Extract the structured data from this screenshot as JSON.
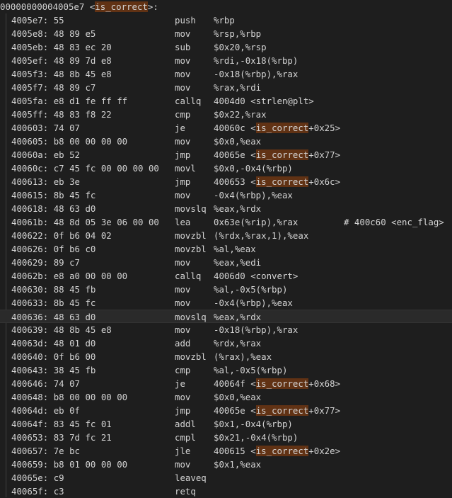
{
  "header": {
    "address": "00000000004005e7",
    "open": "<",
    "symbol": "is_correct",
    "close": ">:"
  },
  "lines": [
    {
      "addr": "4005e7:",
      "bytes": "55",
      "mnem": "push",
      "ops": "%rbp"
    },
    {
      "addr": "4005e8:",
      "bytes": "48 89 e5",
      "mnem": "mov",
      "ops": "%rsp,%rbp"
    },
    {
      "addr": "4005eb:",
      "bytes": "48 83 ec 20",
      "mnem": "sub",
      "ops": "$0x20,%rsp"
    },
    {
      "addr": "4005ef:",
      "bytes": "48 89 7d e8",
      "mnem": "mov",
      "ops": "%rdi,-0x18(%rbp)"
    },
    {
      "addr": "4005f3:",
      "bytes": "48 8b 45 e8",
      "mnem": "mov",
      "ops": "-0x18(%rbp),%rax"
    },
    {
      "addr": "4005f7:",
      "bytes": "48 89 c7",
      "mnem": "mov",
      "ops": "%rax,%rdi"
    },
    {
      "addr": "4005fa:",
      "bytes": "e8 d1 fe ff ff",
      "mnem": "callq",
      "ops": "4004d0 <strlen@plt>"
    },
    {
      "addr": "4005ff:",
      "bytes": "48 83 f8 22",
      "mnem": "cmp",
      "ops": "$0x22,%rax"
    },
    {
      "addr": "400603:",
      "bytes": "74 07",
      "mnem": "je",
      "ops_pre": "40060c <",
      "ops_hl": "is_correct",
      "ops_post": "+0x25>"
    },
    {
      "addr": "400605:",
      "bytes": "b8 00 00 00 00",
      "mnem": "mov",
      "ops": "$0x0,%eax"
    },
    {
      "addr": "40060a:",
      "bytes": "eb 52",
      "mnem": "jmp",
      "ops_pre": "40065e <",
      "ops_hl": "is_correct",
      "ops_post": "+0x77>"
    },
    {
      "addr": "40060c:",
      "bytes": "c7 45 fc 00 00 00 00",
      "mnem": "movl",
      "ops": "$0x0,-0x4(%rbp)"
    },
    {
      "addr": "400613:",
      "bytes": "eb 3e",
      "mnem": "jmp",
      "ops_pre": "400653 <",
      "ops_hl": "is_correct",
      "ops_post": "+0x6c>"
    },
    {
      "addr": "400615:",
      "bytes": "8b 45 fc",
      "mnem": "mov",
      "ops": "-0x4(%rbp),%eax"
    },
    {
      "addr": "400618:",
      "bytes": "48 63 d0",
      "mnem": "movslq",
      "ops": "%eax,%rdx"
    },
    {
      "addr": "40061b:",
      "bytes": "48 8d 05 3e 06 00 00",
      "mnem": "lea",
      "ops": "0x63e(%rip),%rax",
      "comment": "# 400c60 <enc_flag>"
    },
    {
      "addr": "400622:",
      "bytes": "0f b6 04 02",
      "mnem": "movzbl",
      "ops": "(%rdx,%rax,1),%eax"
    },
    {
      "addr": "400626:",
      "bytes": "0f b6 c0",
      "mnem": "movzbl",
      "ops": "%al,%eax"
    },
    {
      "addr": "400629:",
      "bytes": "89 c7",
      "mnem": "mov",
      "ops": "%eax,%edi"
    },
    {
      "addr": "40062b:",
      "bytes": "e8 a0 00 00 00",
      "mnem": "callq",
      "ops": "4006d0 <convert>"
    },
    {
      "addr": "400630:",
      "bytes": "88 45 fb",
      "mnem": "mov",
      "ops": "%al,-0x5(%rbp)"
    },
    {
      "addr": "400633:",
      "bytes": "8b 45 fc",
      "mnem": "mov",
      "ops": "-0x4(%rbp),%eax"
    },
    {
      "addr": "400636:",
      "bytes": "48 63 d0",
      "mnem": "movslq",
      "ops": "%eax,%rdx",
      "current": true
    },
    {
      "addr": "400639:",
      "bytes": "48 8b 45 e8",
      "mnem": "mov",
      "ops": "-0x18(%rbp),%rax"
    },
    {
      "addr": "40063d:",
      "bytes": "48 01 d0",
      "mnem": "add",
      "ops": "%rdx,%rax"
    },
    {
      "addr": "400640:",
      "bytes": "0f b6 00",
      "mnem": "movzbl",
      "ops": "(%rax),%eax"
    },
    {
      "addr": "400643:",
      "bytes": "38 45 fb",
      "mnem": "cmp",
      "ops": "%al,-0x5(%rbp)"
    },
    {
      "addr": "400646:",
      "bytes": "74 07",
      "mnem": "je",
      "ops_pre": "40064f <",
      "ops_hl": "is_correct",
      "ops_post": "+0x68>"
    },
    {
      "addr": "400648:",
      "bytes": "b8 00 00 00 00",
      "mnem": "mov",
      "ops": "$0x0,%eax"
    },
    {
      "addr": "40064d:",
      "bytes": "eb 0f",
      "mnem": "jmp",
      "ops_pre": "40065e <",
      "ops_hl": "is_correct",
      "ops_post": "+0x77>"
    },
    {
      "addr": "40064f:",
      "bytes": "83 45 fc 01",
      "mnem": "addl",
      "ops": "$0x1,-0x4(%rbp)"
    },
    {
      "addr": "400653:",
      "bytes": "83 7d fc 21",
      "mnem": "cmpl",
      "ops": "$0x21,-0x4(%rbp)"
    },
    {
      "addr": "400657:",
      "bytes": "7e bc",
      "mnem": "jle",
      "ops_pre": "400615 <",
      "ops_hl": "is_correct",
      "ops_post": "+0x2e>"
    },
    {
      "addr": "400659:",
      "bytes": "b8 01 00 00 00",
      "mnem": "mov",
      "ops": "$0x1,%eax"
    },
    {
      "addr": "40065e:",
      "bytes": "c9",
      "mnem": "leaveq",
      "ops": ""
    },
    {
      "addr": "40065f:",
      "bytes": "c3",
      "mnem": "retq",
      "ops": ""
    }
  ],
  "colors": {
    "background": "#1e1e1e",
    "text": "#d4d4d4",
    "highlight": "#613214",
    "current_line": "#2a2a2a",
    "indent_guide": "#404040"
  }
}
